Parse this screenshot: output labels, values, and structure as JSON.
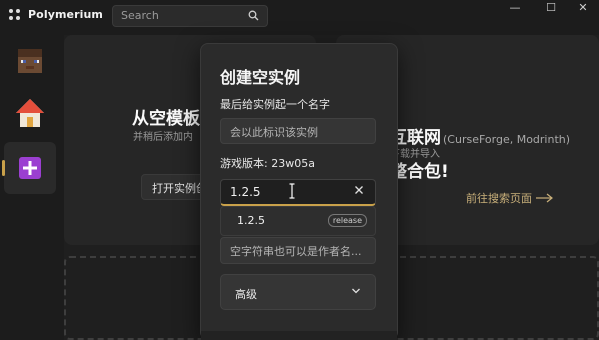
{
  "app": {
    "title": "Polymerium"
  },
  "search": {
    "placeholder": "Search"
  },
  "window": {
    "minimize": "—",
    "maximize": "☐",
    "close": "✕"
  },
  "sidebar": {
    "items": [
      {
        "icon": "steve-head-icon"
      },
      {
        "icon": "home-icon"
      },
      {
        "icon": "plus-icon",
        "selected": true
      }
    ]
  },
  "left_card": {
    "heading": "从空模板创",
    "sub": "并稍后添加内",
    "button": "打开实例创建"
  },
  "right_card": {
    "heading": "互联网",
    "sources": "(CurseForge, Modrinth)",
    "sub": "下载并导入",
    "big": "整合包!",
    "link": "前往搜索页面"
  },
  "dialog": {
    "title": "创建空实例",
    "name_label": "最后给实例起一个名字",
    "name_placeholder": "会以此标识该实例",
    "version_label": "游戏版本: 23w05a",
    "version_value": "1.2.5",
    "suggestion": {
      "label": "1.2.5",
      "tag": "release"
    },
    "author_placeholder": "空字符串也可以是作者名...",
    "advanced": "高级"
  },
  "colors": {
    "accent": "#c9a14a",
    "background": "#1c1c1c",
    "dialog": "#2b2b2b",
    "purple": "#9b3fd1"
  }
}
